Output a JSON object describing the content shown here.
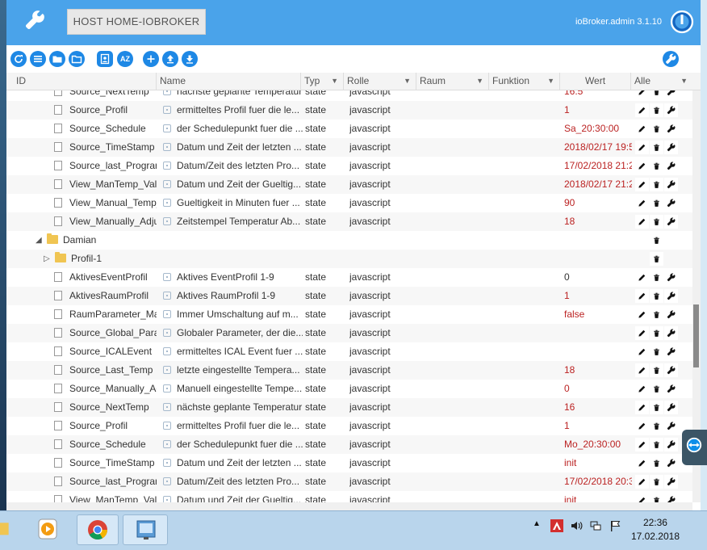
{
  "header": {
    "host_button": "HOST HOME-IOBROKER",
    "version": "ioBroker.admin 3.1.10"
  },
  "toolbar_icons": [
    "refresh-icon",
    "list-icon",
    "folder-icon",
    "folder-open-icon",
    "contacts-icon",
    "sort-az-icon",
    "add-icon",
    "upload-icon",
    "download-icon",
    "settings-wrench-icon"
  ],
  "columns": [
    {
      "label": "ID",
      "filter": false
    },
    {
      "label": "Name",
      "filter": false
    },
    {
      "label": "Typ",
      "filter": true
    },
    {
      "label": "Rolle",
      "filter": true
    },
    {
      "label": "Raum",
      "filter": true
    },
    {
      "label": "Funktion",
      "filter": true
    },
    {
      "label": "Wert",
      "filter": false
    },
    {
      "label": "Alle",
      "filter": true
    }
  ],
  "rows": [
    {
      "kind": "state",
      "id": "Source_NextTemp",
      "name": "nächste geplante Temperatur",
      "typ": "state",
      "rolle": "javascript",
      "wert": "16.5"
    },
    {
      "kind": "state",
      "id": "Source_Profil",
      "name": "ermitteltes Profil fuer die le...",
      "typ": "state",
      "rolle": "javascript",
      "wert": "1"
    },
    {
      "kind": "state",
      "id": "Source_Schedule",
      "name": "der Schedulepunkt fuer die ...",
      "typ": "state",
      "rolle": "javascript",
      "wert": "Sa_20:30:00"
    },
    {
      "kind": "state",
      "id": "Source_TimeStamp",
      "name": "Datum und Zeit der letzten ...",
      "typ": "state",
      "rolle": "javascript",
      "wert": "2018/02/17 19:5"
    },
    {
      "kind": "state",
      "id": "Source_last_Program",
      "name": "Datum/Zeit des letzten Pro...",
      "typ": "state",
      "rolle": "javascript",
      "wert": "17/02/2018 21:2"
    },
    {
      "kind": "state",
      "id": "View_ManTemp_Vali",
      "name": "Datum und Zeit der Gueltig...",
      "typ": "state",
      "rolle": "javascript",
      "wert": "2018/02/17 21:2"
    },
    {
      "kind": "state",
      "id": "View_Manual_Temp_",
      "name": "Gueltigkeit in Minuten fuer ...",
      "typ": "state",
      "rolle": "javascript",
      "wert": "90"
    },
    {
      "kind": "state",
      "id": "View_Manually_Adju",
      "name": "Zeitstempel Temperatur Ab...",
      "typ": "state",
      "rolle": "javascript",
      "wert": "18"
    },
    {
      "kind": "folder",
      "id": "Damian",
      "expanded": true,
      "level": 0
    },
    {
      "kind": "folder",
      "id": "Profil-1",
      "expanded": false,
      "level": 1
    },
    {
      "kind": "state",
      "id": "AktivesEventProfil",
      "name": "Aktives EventProfil 1-9",
      "typ": "state",
      "rolle": "javascript",
      "wert": "0",
      "plain": true
    },
    {
      "kind": "state",
      "id": "AktivesRaumProfil",
      "name": "Aktives RaumProfil 1-9",
      "typ": "state",
      "rolle": "javascript",
      "wert": "1"
    },
    {
      "kind": "state",
      "id": "RaumParameter_Mai",
      "name": "Immer Umschaltung auf m...",
      "typ": "state",
      "rolle": "javascript",
      "wert": "false"
    },
    {
      "kind": "state",
      "id": "Source_Global_Parar",
      "name": "Globaler Parameter, der die...",
      "typ": "state",
      "rolle": "javascript",
      "wert": ""
    },
    {
      "kind": "state",
      "id": "Source_ICALEvent",
      "name": "ermitteltes ICAL Event fuer ...",
      "typ": "state",
      "rolle": "javascript",
      "wert": ""
    },
    {
      "kind": "state",
      "id": "Source_Last_Temp",
      "name": "letzte eingestellte Tempera...",
      "typ": "state",
      "rolle": "javascript",
      "wert": "18"
    },
    {
      "kind": "state",
      "id": "Source_Manually_Adj",
      "name": "Manuell eingestellte Tempe...",
      "typ": "state",
      "rolle": "javascript",
      "wert": "0"
    },
    {
      "kind": "state",
      "id": "Source_NextTemp",
      "name": "nächste geplante Temperatur",
      "typ": "state",
      "rolle": "javascript",
      "wert": "16"
    },
    {
      "kind": "state",
      "id": "Source_Profil",
      "name": "ermitteltes Profil fuer die le...",
      "typ": "state",
      "rolle": "javascript",
      "wert": "1"
    },
    {
      "kind": "state",
      "id": "Source_Schedule",
      "name": "der Schedulepunkt fuer die ...",
      "typ": "state",
      "rolle": "javascript",
      "wert": "Mo_20:30:00"
    },
    {
      "kind": "state",
      "id": "Source_TimeStamp",
      "name": "Datum und Zeit der letzten ...",
      "typ": "state",
      "rolle": "javascript",
      "wert": "init"
    },
    {
      "kind": "state",
      "id": "Source_last_Program",
      "name": "Datum/Zeit des letzten Pro...",
      "typ": "state",
      "rolle": "javascript",
      "wert": "17/02/2018 20:3"
    },
    {
      "kind": "state",
      "id": "View_ManTemp_Vali",
      "name": "Datum und Zeit der Gueltig...",
      "typ": "state",
      "rolle": "javascript",
      "wert": "init"
    }
  ],
  "taskbar": {
    "apps": [
      "explorer-icon",
      "media-player-icon",
      "chrome-icon",
      "network-app-icon"
    ],
    "tray_icons": [
      "show-hidden-icons",
      "antivirus-icon",
      "volume-icon",
      "network-icon",
      "flag-icon"
    ],
    "time": "22:36",
    "date": "17.02.2018"
  },
  "colors": {
    "header": "#4aa3ea",
    "accent": "#1e88e5",
    "value": "#b22222"
  }
}
